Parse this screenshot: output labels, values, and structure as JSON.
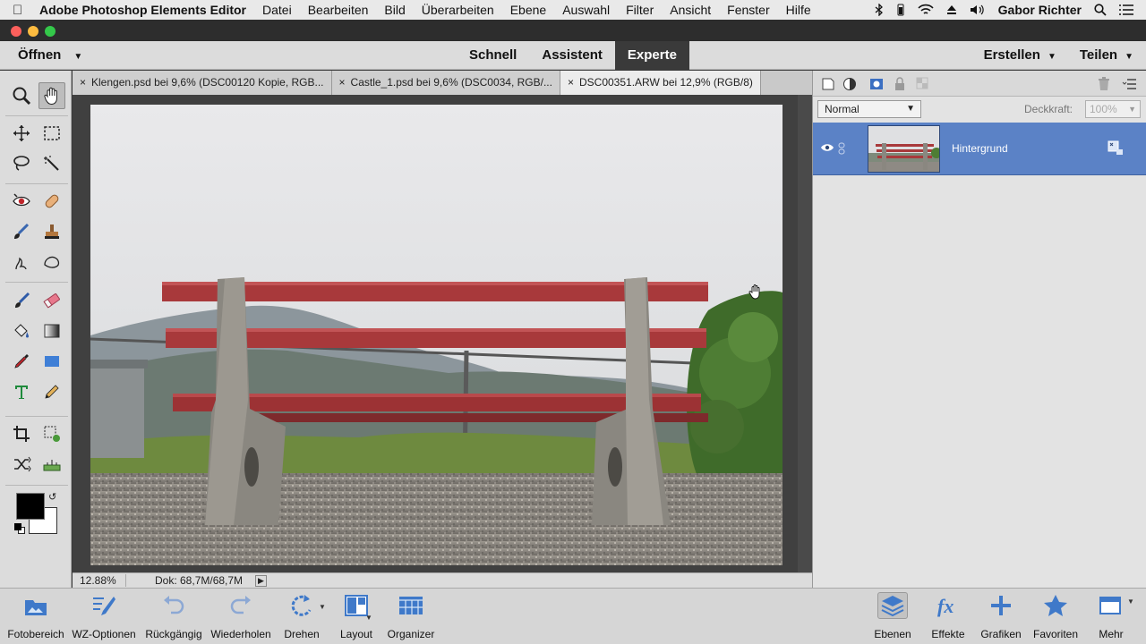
{
  "menubar": {
    "app": "Adobe Photoshop Elements Editor",
    "items": [
      "Datei",
      "Bearbeiten",
      "Bild",
      "Überarbeiten",
      "Ebene",
      "Auswahl",
      "Filter",
      "Ansicht",
      "Fenster",
      "Hilfe"
    ],
    "user": "Gabor Richter"
  },
  "modebar": {
    "open": "Öffnen",
    "modes": [
      "Schnell",
      "Assistent",
      "Experte"
    ],
    "active_mode": "Experte",
    "create": "Erstellen",
    "share": "Teilen"
  },
  "tabs": [
    {
      "label": "Klengen.psd bei 9,6% (DSC00120 Kopie, RGB..."
    },
    {
      "label": "Castle_1.psd bei 9,6% (DSC0034, RGB/..."
    },
    {
      "label": "DSC00351.ARW bei 12,9% (RGB/8)"
    }
  ],
  "status": {
    "zoom": "12.88%",
    "doc": "Dok: 68,7M/68,7M"
  },
  "layers": {
    "blend_mode": "Normal",
    "opacity_label": "Deckkraft:",
    "opacity_value": "100%",
    "layer_name": "Hintergrund"
  },
  "taskbar": {
    "left": [
      {
        "label": "Fotobereich",
        "icon": "photo-bin-icon"
      },
      {
        "label": "WZ-Optionen",
        "icon": "tool-options-icon"
      },
      {
        "label": "Rückgängig",
        "icon": "undo-icon"
      },
      {
        "label": "Wiederholen",
        "icon": "redo-icon"
      },
      {
        "label": "Drehen",
        "icon": "rotate-icon"
      },
      {
        "label": "Layout",
        "icon": "layout-icon"
      },
      {
        "label": "Organizer",
        "icon": "organizer-icon"
      }
    ],
    "right": [
      {
        "label": "Ebenen",
        "icon": "layers-icon"
      },
      {
        "label": "Effekte",
        "icon": "fx-icon"
      },
      {
        "label": "Grafiken",
        "icon": "plus-icon"
      },
      {
        "label": "Favoriten",
        "icon": "star-icon"
      },
      {
        "label": "Mehr",
        "icon": "more-icon"
      }
    ]
  },
  "colors": {
    "accent_layer": "#5b82c6",
    "bench_red": "#a8393b"
  }
}
